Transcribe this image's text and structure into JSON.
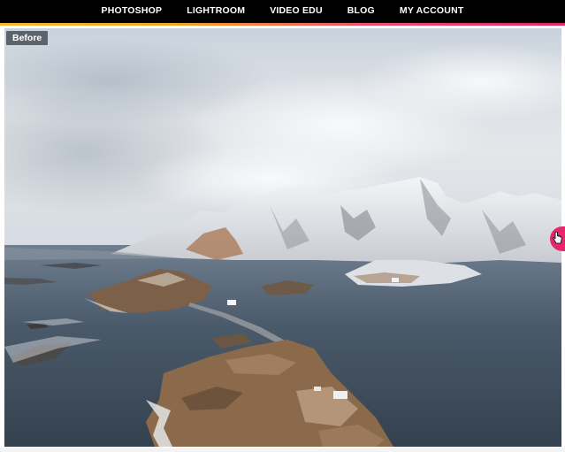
{
  "nav": {
    "items": [
      {
        "label": "PHOTOSHOP"
      },
      {
        "label": "LIGHTROOM"
      },
      {
        "label": "VIDEO EDU"
      },
      {
        "label": "BLOG"
      },
      {
        "label": "MY ACCOUNT"
      }
    ]
  },
  "comparison": {
    "before_label": "Before",
    "slider_position": 1.0,
    "handle_color": "#e8266d"
  },
  "icons": {
    "handle_cursor": "hand-pointer-icon"
  },
  "colors": {
    "nav_background": "#000000",
    "nav_text": "#ffffff",
    "badge_background": "#5d636a",
    "accent_start": "#f7b731",
    "accent_end": "#e8266d"
  }
}
